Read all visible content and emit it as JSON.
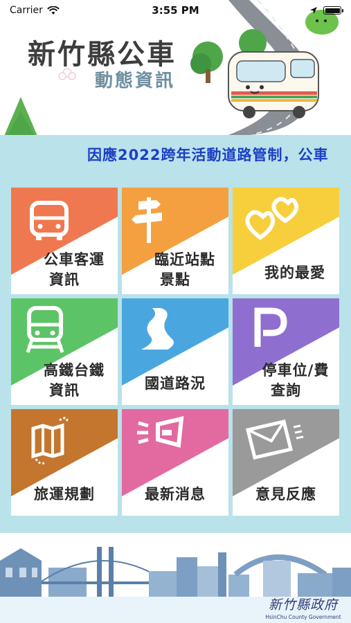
{
  "status_bar": {
    "carrier": "Carrier",
    "time": "3:55 PM",
    "battery_level": 1.0
  },
  "header": {
    "title": "新竹縣公車",
    "subtitle": "動態資訊"
  },
  "marquee_text": "因應2022跨年活動道路管制，公車",
  "tiles": [
    {
      "line1": "公車客運",
      "line2": "資訊",
      "icon": "bus-icon",
      "color": "#f07850"
    },
    {
      "line1": "臨近站點",
      "line2": "景點",
      "icon": "signpost-icon",
      "color": "#f5a040"
    },
    {
      "line1": "我的最愛",
      "line2": "",
      "icon": "hearts-icon",
      "color": "#f7cf3c"
    },
    {
      "line1": "高鐵台鐵",
      "line2": "資訊",
      "icon": "train-icon",
      "color": "#5cc466"
    },
    {
      "line1": "國道路況",
      "line2": "",
      "icon": "road-icon",
      "color": "#4aa6df"
    },
    {
      "line1": "停車位/費",
      "line2": "查詢",
      "icon": "parking-icon",
      "color": "#8e6fd0"
    },
    {
      "line1": "旅運規劃",
      "line2": "",
      "icon": "map-icon",
      "color": "#c4762e"
    },
    {
      "line1": "最新消息",
      "line2": "",
      "icon": "megaphone-icon",
      "color": "#e36aa0"
    },
    {
      "line1": "意見反應",
      "line2": "",
      "icon": "mail-icon",
      "color": "#9a9a9a"
    }
  ],
  "footer": {
    "logo_cn": "新竹縣政府",
    "logo_en": "HsinChu County Government"
  }
}
